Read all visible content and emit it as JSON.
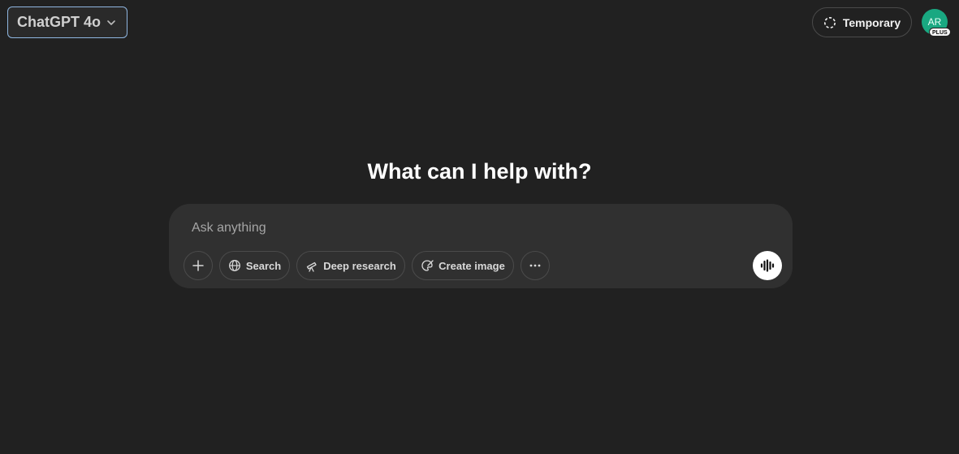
{
  "header": {
    "model_label": "ChatGPT 4o",
    "temporary_label": "Temporary",
    "avatar_initials": "AR",
    "plan_badge": "PLUS"
  },
  "main": {
    "heading": "What can I help with?"
  },
  "composer": {
    "value": "",
    "placeholder": "Ask anything",
    "tools": {
      "search_label": "Search",
      "deep_research_label": "Deep research",
      "create_image_label": "Create image"
    }
  },
  "icons": {
    "model": "chevron-down-icon",
    "temporary": "dashed-circle-icon",
    "attach": "plus-icon",
    "search": "globe-icon",
    "deep_research": "telescope-icon",
    "create_image": "paint-palette-icon",
    "more": "ellipsis-icon",
    "voice": "voice-waveform-icon"
  },
  "colors": {
    "background": "#212121",
    "composer": "#303030",
    "avatar": "#19a881",
    "focus_ring": "#8fb6e0"
  }
}
